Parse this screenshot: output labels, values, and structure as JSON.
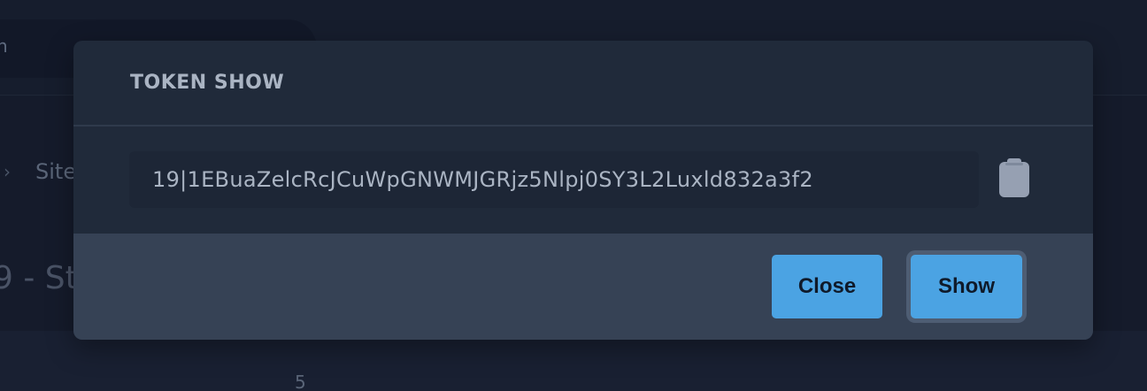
{
  "background": {
    "search_partial": "n",
    "breadcrumb_partial": "Site",
    "title_partial": "9 - St",
    "number": "5"
  },
  "modal": {
    "title": "TOKEN SHOW",
    "token_value": "19|1EBuaZelcRcJCuWpGNWMJGRjz5Nlpj0SY3L2Luxld832a3f2",
    "copy_icon": "clipboard-icon",
    "close_label": "Close",
    "show_label": "Show"
  },
  "colors": {
    "modal_bg": "#202a3a",
    "footer_bg": "#364255",
    "button_bg": "#4ba3e3",
    "text_muted": "#aab4c3"
  }
}
